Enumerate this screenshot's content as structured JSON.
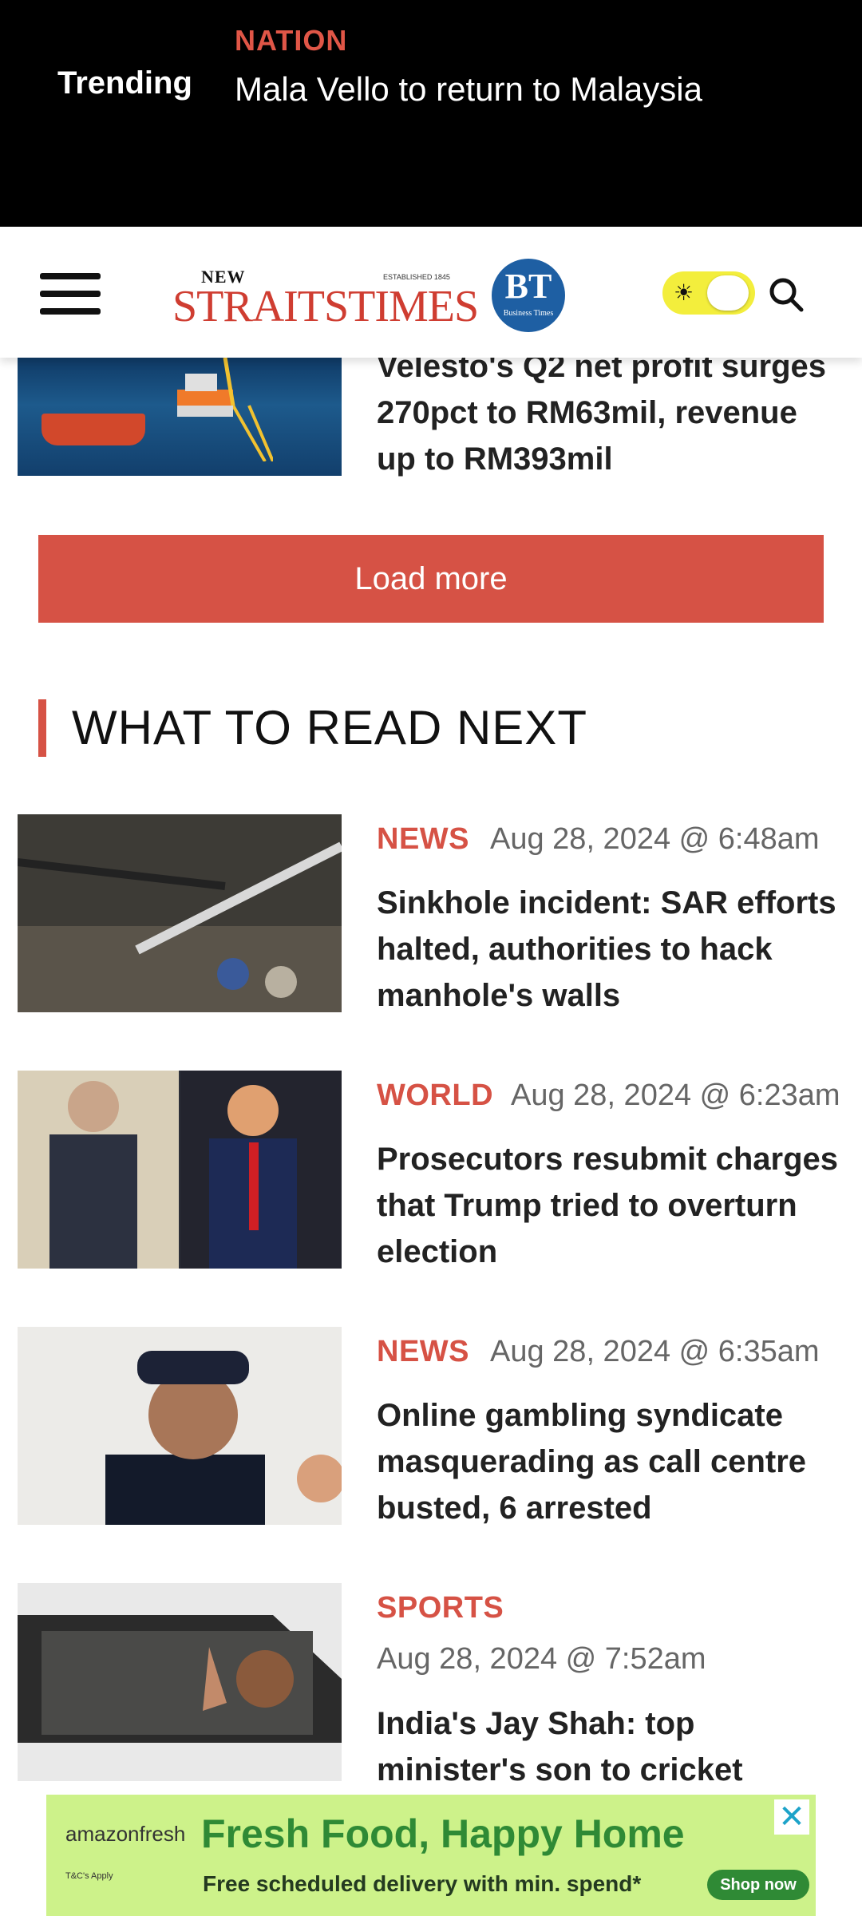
{
  "trending": {
    "label": "Trending",
    "category": "NATION",
    "headline": "Mala Vello to return to Malaysia"
  },
  "header": {
    "logo_new": "NEW",
    "logo_est": "ESTABLISHED 1845",
    "logo_main": "STRAITSTIMES",
    "bt_logo": "BT",
    "bt_sub": "Business Times",
    "toggle_icon": "sun-icon"
  },
  "partial_article": {
    "title": "Velesto's Q2 net profit surges 270pct to RM63mil, revenue up to RM393mil"
  },
  "load_more_label": "Load more",
  "section_title": "WHAT TO READ NEXT",
  "articles": [
    {
      "category": "NEWS",
      "date": "Aug 28, 2024 @ 6:48am",
      "title": "Sinkhole incident: SAR efforts halted, authorities to hack manhole's walls"
    },
    {
      "category": "WORLD",
      "date": "Aug 28, 2024 @ 6:23am",
      "title": "Prosecutors resubmit charges that Trump tried to overturn election"
    },
    {
      "category": "NEWS",
      "date": "Aug 28, 2024 @ 6:35am",
      "title": "Online gambling syndicate masquerading as call centre busted, 6 arrested"
    },
    {
      "category": "SPORTS",
      "date": "Aug 28, 2024 @ 7:52am",
      "title": "India's Jay Shah: top minister's son to cricket"
    }
  ],
  "ad": {
    "brand": "amazonfresh",
    "headline": "Fresh Food, Happy Home",
    "terms": "T&C's Apply",
    "subtext": "Free scheduled delivery with min. spend*",
    "shop_label": "Shop now",
    "close": "✕"
  },
  "colors": {
    "accent": "#d65245",
    "toggle": "#f3ee3c",
    "ad_bg": "#cdf28a",
    "bt_blue": "#1e5fa3"
  }
}
